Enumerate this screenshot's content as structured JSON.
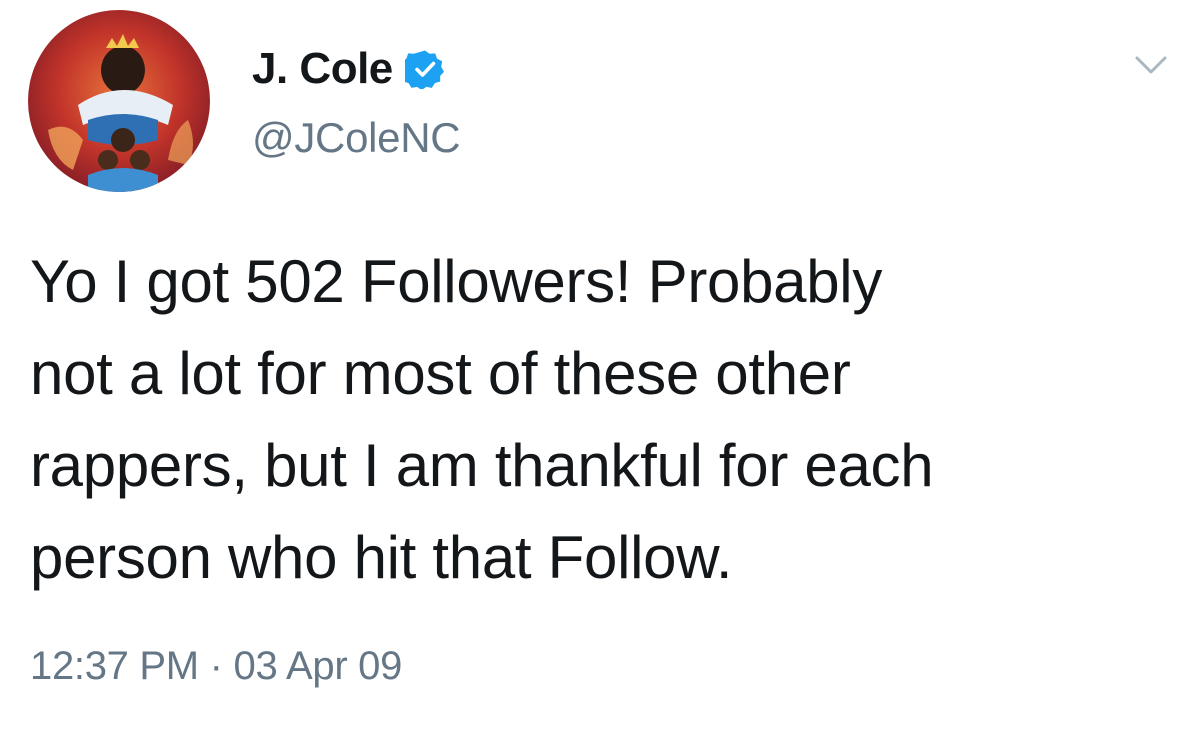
{
  "author": {
    "display_name": "J. Cole",
    "handle": "@JColeNC",
    "verified": true,
    "verified_color": "#1da1f2"
  },
  "tweet": {
    "lines": [
      "Yo I got 502 Followers! Probably",
      "not a lot for most of these other",
      "rappers, but I am thankful for each",
      "person who hit that Follow."
    ]
  },
  "meta": {
    "time": "12:37 PM",
    "separator": "·",
    "date": "03 Apr 09"
  },
  "icons": {
    "verified": "verified-badge-icon",
    "menu": "chevron-down-icon"
  }
}
